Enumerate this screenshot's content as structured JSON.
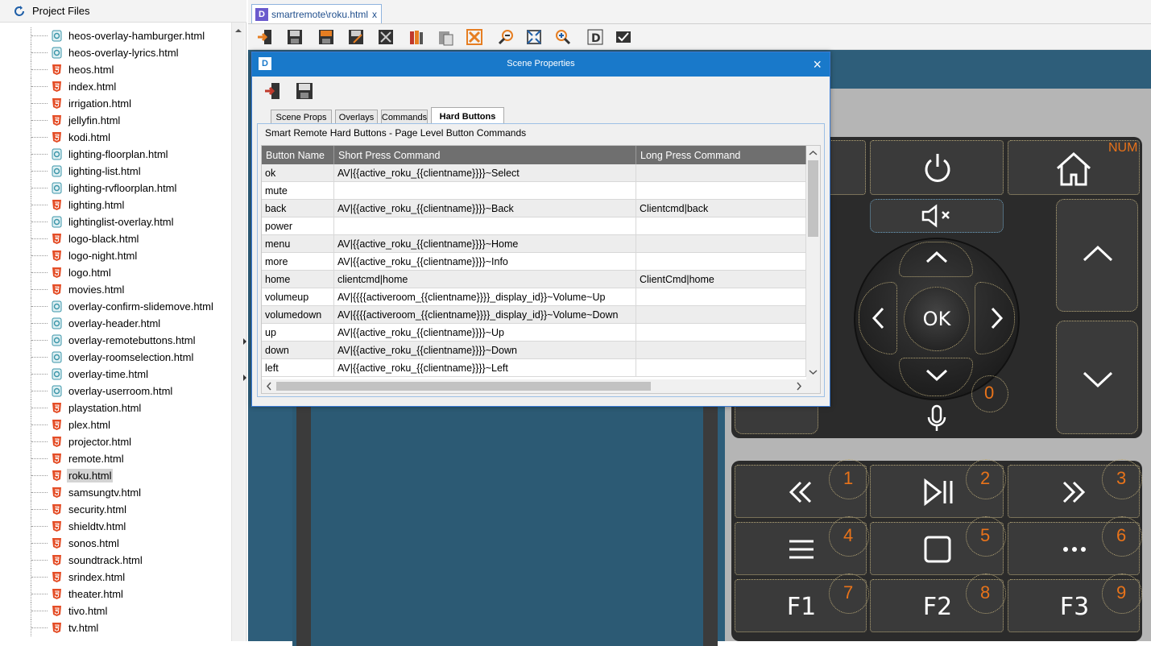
{
  "project_panel": {
    "title": "Project Files",
    "files": [
      {
        "name": "heos-overlay-hamburger.html",
        "type": "overlay"
      },
      {
        "name": "heos-overlay-lyrics.html",
        "type": "overlay"
      },
      {
        "name": "heos.html",
        "type": "html"
      },
      {
        "name": "index.html",
        "type": "html"
      },
      {
        "name": "irrigation.html",
        "type": "html"
      },
      {
        "name": "jellyfin.html",
        "type": "html"
      },
      {
        "name": "kodi.html",
        "type": "html"
      },
      {
        "name": "lighting-floorplan.html",
        "type": "overlay"
      },
      {
        "name": "lighting-list.html",
        "type": "overlay"
      },
      {
        "name": "lighting-rvfloorplan.html",
        "type": "overlay"
      },
      {
        "name": "lighting.html",
        "type": "html"
      },
      {
        "name": "lightinglist-overlay.html",
        "type": "overlay"
      },
      {
        "name": "logo-black.html",
        "type": "html"
      },
      {
        "name": "logo-night.html",
        "type": "html"
      },
      {
        "name": "logo.html",
        "type": "html"
      },
      {
        "name": "movies.html",
        "type": "html"
      },
      {
        "name": "overlay-confirm-slidemove.html",
        "type": "overlay"
      },
      {
        "name": "overlay-header.html",
        "type": "overlay"
      },
      {
        "name": "overlay-remotebuttons.html",
        "type": "overlay"
      },
      {
        "name": "overlay-roomselection.html",
        "type": "overlay"
      },
      {
        "name": "overlay-time.html",
        "type": "overlay"
      },
      {
        "name": "overlay-userroom.html",
        "type": "overlay"
      },
      {
        "name": "playstation.html",
        "type": "html"
      },
      {
        "name": "plex.html",
        "type": "html"
      },
      {
        "name": "projector.html",
        "type": "html"
      },
      {
        "name": "remote.html",
        "type": "html"
      },
      {
        "name": "roku.html",
        "type": "html",
        "selected": true
      },
      {
        "name": "samsungtv.html",
        "type": "html"
      },
      {
        "name": "security.html",
        "type": "html"
      },
      {
        "name": "shieldtv.html",
        "type": "html"
      },
      {
        "name": "sonos.html",
        "type": "html"
      },
      {
        "name": "soundtrack.html",
        "type": "html"
      },
      {
        "name": "srindex.html",
        "type": "html"
      },
      {
        "name": "theater.html",
        "type": "html"
      },
      {
        "name": "tivo.html",
        "type": "html"
      },
      {
        "name": "tv.html",
        "type": "html"
      }
    ]
  },
  "editor": {
    "tab_label": "smartremote\\roku.html",
    "tab_close": "x",
    "toolbar_icons": [
      "import-icon",
      "save-icon",
      "save-all-icon",
      "save-as-icon",
      "close-doc-icon",
      "library-icon",
      "paste-icon",
      "delete-icon",
      "zoom-out-icon",
      "fit-icon",
      "zoom-in-icon",
      "designer-icon",
      "preview-icon"
    ]
  },
  "dialog": {
    "title": "Scene Properties",
    "close": "×",
    "tabs": [
      "Scene Props",
      "Overlays",
      "Commands",
      "Hard Buttons"
    ],
    "active_tab": "Hard Buttons",
    "group_label": "Smart Remote Hard Buttons - Page Level Button Commands",
    "columns": [
      "Button Name",
      "Short Press Command",
      "Long Press Command"
    ],
    "rows": [
      [
        "ok",
        "AV|{{active_roku_{{clientname}}}}~Select",
        ""
      ],
      [
        "mute",
        "",
        ""
      ],
      [
        "back",
        "AV|{{active_roku_{{clientname}}}}~Back",
        "Clientcmd|back"
      ],
      [
        "power",
        "",
        ""
      ],
      [
        "menu",
        "AV|{{active_roku_{{clientname}}}}~Home",
        ""
      ],
      [
        "more",
        "AV|{{active_roku_{{clientname}}}}~Info",
        ""
      ],
      [
        "home",
        "clientcmd|home",
        "ClientCmd|home"
      ],
      [
        "volumeup",
        "AV|{{{{activeroom_{{clientname}}}}_display_id}}~Volume~Up",
        ""
      ],
      [
        "volumedown",
        "AV|{{{{activeroom_{{clientname}}}}_display_id}}~Volume~Down",
        ""
      ],
      [
        "up",
        "AV|{{active_roku_{{clientname}}}}~Up",
        ""
      ],
      [
        "down",
        "AV|{{active_roku_{{clientname}}}}~Down",
        ""
      ],
      [
        "left",
        "AV|{{active_roku_{{clientname}}}}~Left",
        ""
      ]
    ]
  },
  "remote": {
    "num_label": "NUM",
    "ok_label": "OK",
    "digits": [
      "1",
      "2",
      "3",
      "4",
      "5",
      "6",
      "7",
      "8",
      "9",
      "0"
    ],
    "fkeys": [
      "F1",
      "F2",
      "F3"
    ],
    "colors": {
      "accent": "#e8731a",
      "pad": "#3a3a3a",
      "canvas": "#2e5e7a"
    }
  }
}
